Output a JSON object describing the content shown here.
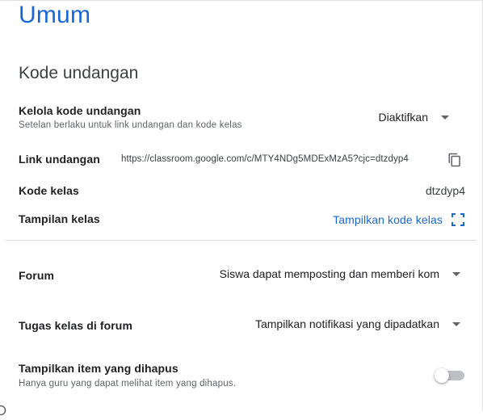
{
  "page": {
    "title": "Umum"
  },
  "invite_section": {
    "title": "Kode undangan",
    "manage": {
      "label": "Kelola kode undangan",
      "description": "Setelan berlaku untuk link undangan dan kode kelas",
      "selected": "Diaktifkan"
    },
    "invite_link": {
      "label": "Link undangan",
      "url": "https://classroom.google.com/c/MTY4NDg5MDExMzA5?cjc=dtzdyp4",
      "copy_icon": "copy-icon"
    },
    "class_code": {
      "label": "Kode kelas",
      "value": "dtzdyp4"
    },
    "class_display": {
      "label": "Tampilan kelas",
      "action": "Tampilkan kode kelas",
      "icon": "fullscreen-icon"
    }
  },
  "stream": {
    "forum": {
      "label": "Forum",
      "selected": "Siswa dapat memposting dan memberi kom"
    },
    "classwork": {
      "label": "Tugas kelas di forum",
      "selected": "Tampilkan notifikasi yang dipadatkan"
    },
    "deleted_items": {
      "label": "Tampilkan item yang dihapus",
      "description": "Hanya guru yang dapat melihat item yang dihapus.",
      "enabled": false
    }
  },
  "colors": {
    "accent": "#1967d2",
    "text": "#202124",
    "muted": "#5f6368",
    "divider": "#dadce0"
  }
}
